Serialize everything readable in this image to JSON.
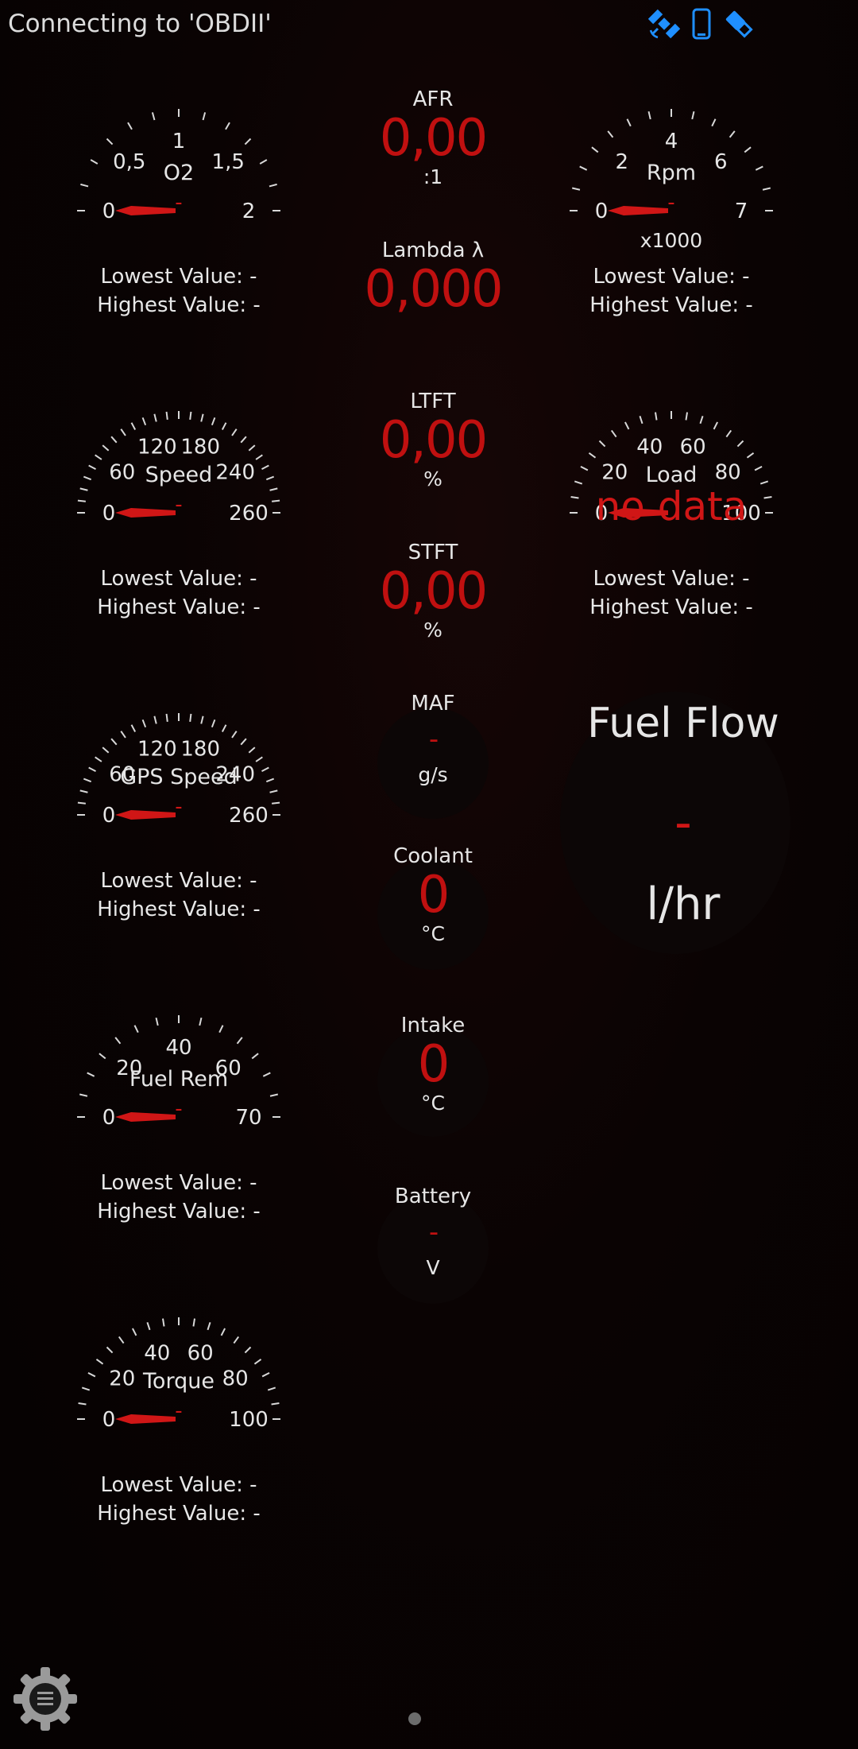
{
  "status": {
    "title": "Connecting to 'OBDII'"
  },
  "icons": {
    "satellite": "satellite-icon",
    "phone": "phone-icon",
    "usb": "usb-icon",
    "menu": "settings-menu-icon"
  },
  "colors": {
    "accent_red": "#d01616",
    "icon_blue": "#1f8fff",
    "background": "#0a0303"
  },
  "gauges": [
    {
      "title": "O2",
      "ticks": [
        "0",
        "0,5",
        "1",
        "1,5",
        "2"
      ],
      "value": "-",
      "lowest": "Lowest Value: -",
      "highest": "Highest Value: -"
    },
    {
      "title": "Rpm",
      "ticks": [
        "0",
        "2",
        "4",
        "6",
        "7"
      ],
      "unit": "x1000",
      "value": "-",
      "lowest": "Lowest Value: -",
      "highest": "Highest Value: -"
    },
    {
      "title": "Speed",
      "ticks": [
        "0",
        "60",
        "120",
        "180",
        "240",
        "260"
      ],
      "value": "-",
      "lowest": "Lowest Value: -",
      "highest": "Highest Value: -"
    },
    {
      "title": "Load",
      "ticks": [
        "0",
        "20",
        "40",
        "60",
        "80",
        "100"
      ],
      "value": "no data",
      "lowest": "Lowest Value: -",
      "highest": "Highest Value: -"
    },
    {
      "title": "GPS Speed",
      "ticks": [
        "0",
        "60",
        "120",
        "180",
        "240",
        "260"
      ],
      "value": "-",
      "lowest": "Lowest Value: -",
      "highest": "Highest Value: -"
    },
    {
      "title": "Fuel Rem",
      "ticks": [
        "0",
        "20",
        "40",
        "60",
        "70"
      ],
      "value": "-",
      "lowest": "Lowest Value: -",
      "highest": "Highest Value: -"
    },
    {
      "title": "Torque",
      "ticks": [
        "0",
        "20",
        "40",
        "60",
        "80",
        "100"
      ],
      "value": "-",
      "lowest": "Lowest Value: -",
      "highest": "Highest Value: -"
    }
  ],
  "digital": [
    {
      "label": "AFR",
      "value": "0,00",
      "unit": ":1"
    },
    {
      "label": "Lambda λ",
      "value": "0,000",
      "unit": ""
    },
    {
      "label": "LTFT",
      "value": "0,00",
      "unit": "%"
    },
    {
      "label": "STFT",
      "value": "0,00",
      "unit": "%"
    },
    {
      "label": "MAF",
      "value": "-",
      "unit": "g/s"
    },
    {
      "label": "Coolant",
      "value": "0",
      "unit": "°C"
    },
    {
      "label": "Intake",
      "value": "0",
      "unit": "°C"
    },
    {
      "label": "Battery",
      "value": "-",
      "unit": "V"
    }
  ],
  "fuel_flow": {
    "title": "Fuel Flow",
    "value": "-",
    "unit": "l/hr"
  }
}
